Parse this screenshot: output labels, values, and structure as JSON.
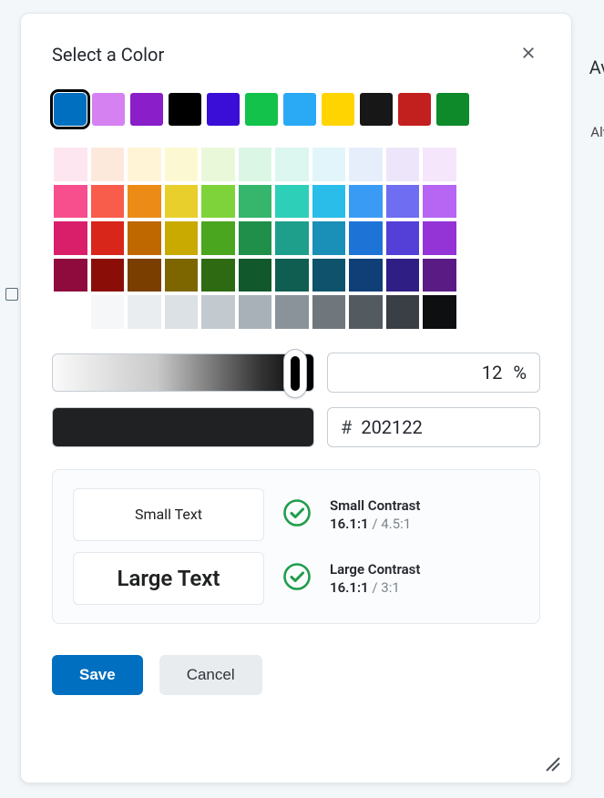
{
  "background": {
    "text1": "Av",
    "text2": "Alv"
  },
  "dialog": {
    "title": "Select a Color",
    "close_label": "Close"
  },
  "presets": [
    {
      "hex": "#006fbf",
      "selected": true
    },
    {
      "hex": "#d581f2",
      "selected": false
    },
    {
      "hex": "#8a1ec9",
      "selected": false
    },
    {
      "hex": "#000000",
      "selected": false
    },
    {
      "hex": "#3a0ed6",
      "selected": false
    },
    {
      "hex": "#12c24a",
      "selected": false
    },
    {
      "hex": "#2aa9f5",
      "selected": false
    },
    {
      "hex": "#ffd400",
      "selected": false
    },
    {
      "hex": "#171717",
      "selected": false
    },
    {
      "hex": "#c21f1f",
      "selected": false
    },
    {
      "hex": "#0e8a2b",
      "selected": false
    }
  ],
  "palette": [
    [
      "#fde6ef",
      "#fde9dc",
      "#fff4d6",
      "#fcf9d2",
      "#eaf8da",
      "#dcf6e5",
      "#dcf6f0",
      "#e2f5fb",
      "#e6eefc",
      "#ede6fb",
      "#f6e6fb"
    ],
    [
      "#f74e8d",
      "#f85c4a",
      "#ec8c17",
      "#e8cf2b",
      "#7fd33a",
      "#36b56d",
      "#2ecfb9",
      "#2bbdea",
      "#3a9bf4",
      "#6f6df2",
      "#b666f2"
    ],
    [
      "#d91f69",
      "#d8261b",
      "#c06800",
      "#c8aa00",
      "#4aa51f",
      "#1f8f4a",
      "#1d9f8c",
      "#1a8fb8",
      "#1e74d6",
      "#5440d6",
      "#9433d6"
    ],
    [
      "#8f0b3e",
      "#8a0e07",
      "#7a3e00",
      "#7d6500",
      "#2d6a12",
      "#11592c",
      "#0f5e51",
      "#0e536b",
      "#103f78",
      "#2f1f85",
      "#5a1b85"
    ],
    [
      "#ffffff",
      "#f5f7f8",
      "#e9edf0",
      "#dbe1e5",
      "#c2cacf",
      "#a8b1b7",
      "#8a9399",
      "#6f777d",
      "#535a60",
      "#393f44",
      "#0d0f11"
    ]
  ],
  "lightness": {
    "percent": "12",
    "suffix": "%"
  },
  "hex": {
    "prefix": "#",
    "value": "202122"
  },
  "preview_color": "#202122",
  "contrast": {
    "small_sample": "Small Text",
    "large_sample": "Large Text",
    "small_title": "Small Contrast",
    "small_ratio": "16.1:1",
    "small_threshold": " / 4.5:1",
    "large_title": "Large Contrast",
    "large_ratio": "16.1:1",
    "large_threshold": " / 3:1"
  },
  "footer": {
    "save": "Save",
    "cancel": "Cancel"
  }
}
